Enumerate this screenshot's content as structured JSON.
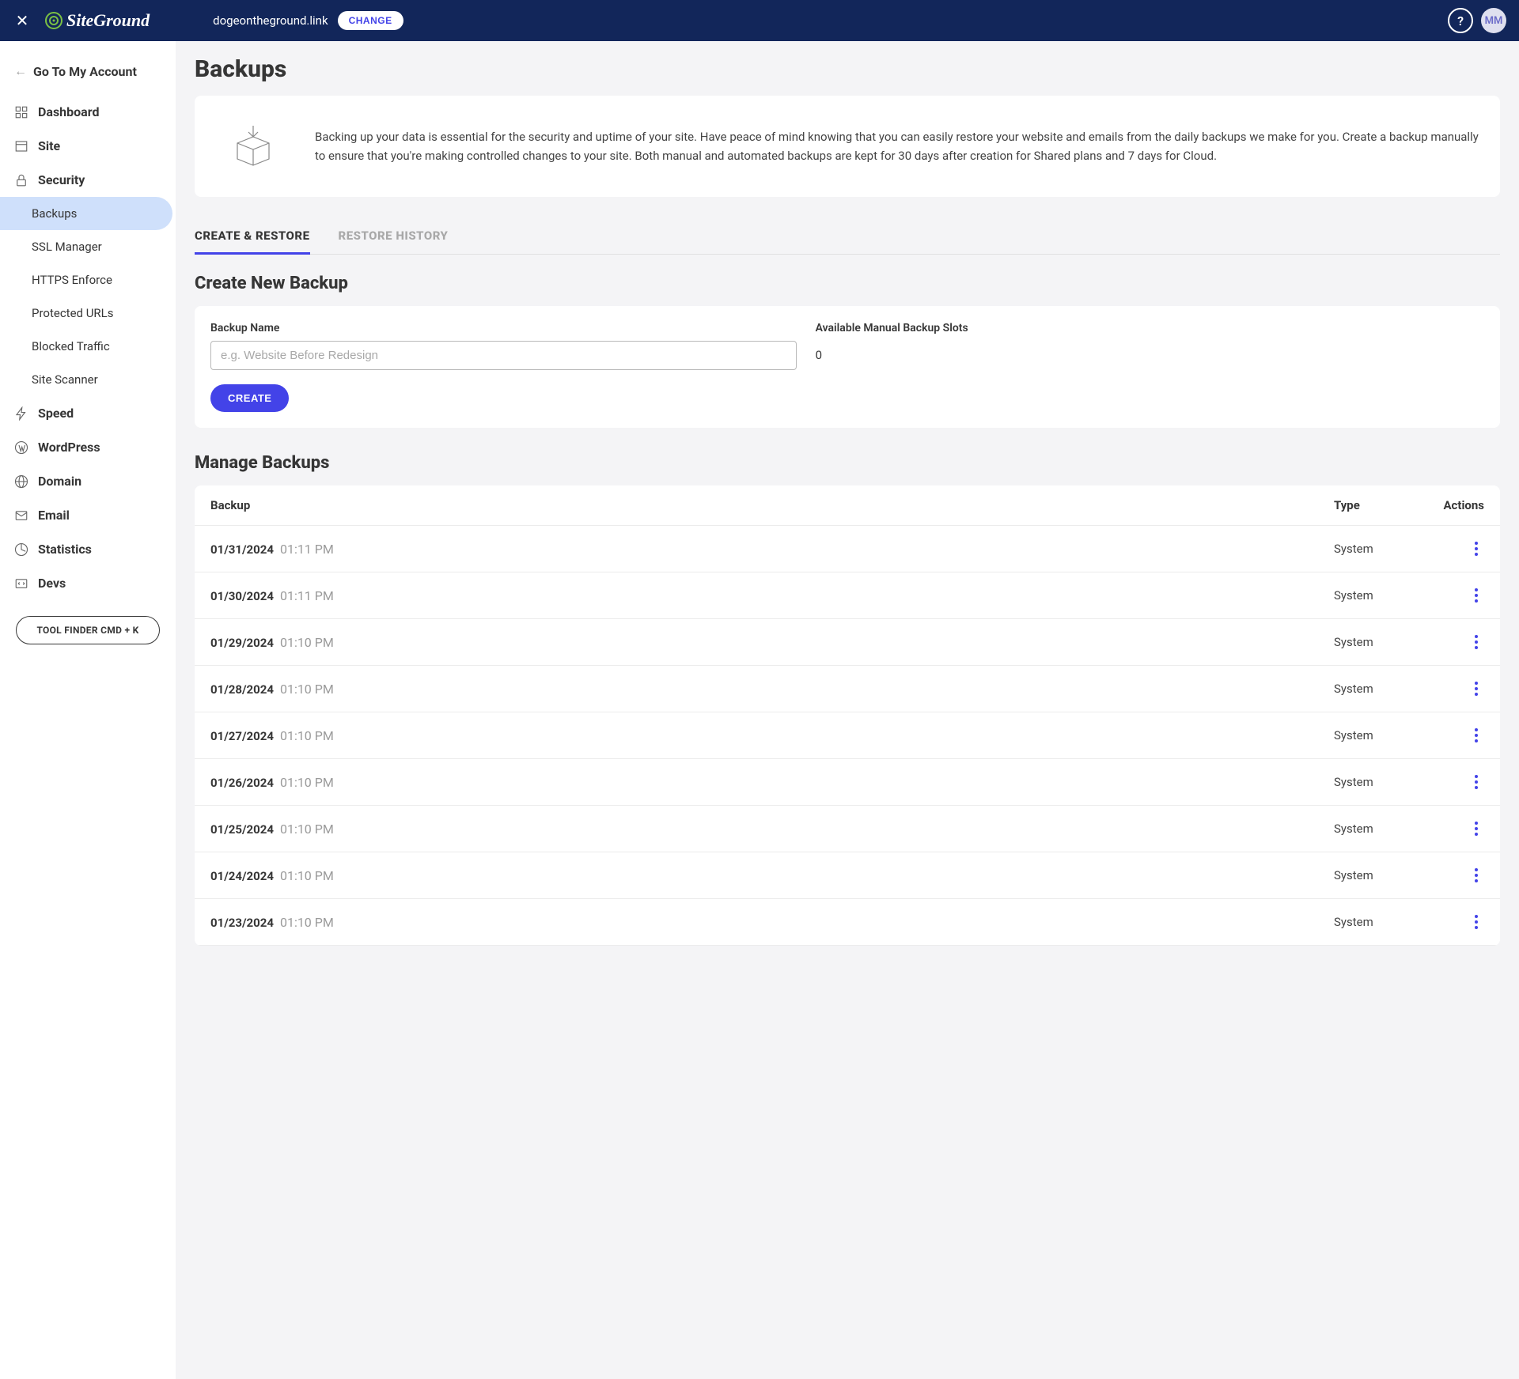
{
  "topbar": {
    "domain": "dogeontheground.link",
    "change_label": "CHANGE",
    "avatar_initials": "MM",
    "logo_text": "SiteGround"
  },
  "sidebar": {
    "go_back": "Go To My Account",
    "items": [
      {
        "label": "Dashboard"
      },
      {
        "label": "Site"
      },
      {
        "label": "Security",
        "children": [
          {
            "label": "Backups",
            "active": true
          },
          {
            "label": "SSL Manager"
          },
          {
            "label": "HTTPS Enforce"
          },
          {
            "label": "Protected URLs"
          },
          {
            "label": "Blocked Traffic"
          },
          {
            "label": "Site Scanner"
          }
        ]
      },
      {
        "label": "Speed"
      },
      {
        "label": "WordPress"
      },
      {
        "label": "Domain"
      },
      {
        "label": "Email"
      },
      {
        "label": "Statistics"
      },
      {
        "label": "Devs"
      }
    ],
    "tool_finder": "TOOL FINDER CMD + K"
  },
  "page": {
    "title": "Backups",
    "intro": "Backing up your data is essential for the security and uptime of your site. Have peace of mind knowing that you can easily restore your website and emails from the daily backups we make for you. Create a backup manually to ensure that you're making controlled changes to your site. Both manual and automated backups are kept for 30 days after creation for Shared plans and 7 days for Cloud.",
    "tabs": [
      {
        "label": "CREATE & RESTORE",
        "active": true
      },
      {
        "label": "RESTORE HISTORY",
        "active": false
      }
    ],
    "create": {
      "section_title": "Create New Backup",
      "name_label": "Backup Name",
      "name_placeholder": "e.g. Website Before Redesign",
      "slots_label": "Available Manual Backup Slots",
      "slots_value": "0",
      "button": "CREATE"
    },
    "manage": {
      "section_title": "Manage Backups",
      "headers": {
        "backup": "Backup",
        "type": "Type",
        "actions": "Actions"
      },
      "rows": [
        {
          "date": "01/31/2024",
          "time": "01:11 PM",
          "type": "System"
        },
        {
          "date": "01/30/2024",
          "time": "01:11 PM",
          "type": "System"
        },
        {
          "date": "01/29/2024",
          "time": "01:10 PM",
          "type": "System"
        },
        {
          "date": "01/28/2024",
          "time": "01:10 PM",
          "type": "System"
        },
        {
          "date": "01/27/2024",
          "time": "01:10 PM",
          "type": "System"
        },
        {
          "date": "01/26/2024",
          "time": "01:10 PM",
          "type": "System"
        },
        {
          "date": "01/25/2024",
          "time": "01:10 PM",
          "type": "System"
        },
        {
          "date": "01/24/2024",
          "time": "01:10 PM",
          "type": "System"
        },
        {
          "date": "01/23/2024",
          "time": "01:10 PM",
          "type": "System"
        }
      ]
    }
  }
}
